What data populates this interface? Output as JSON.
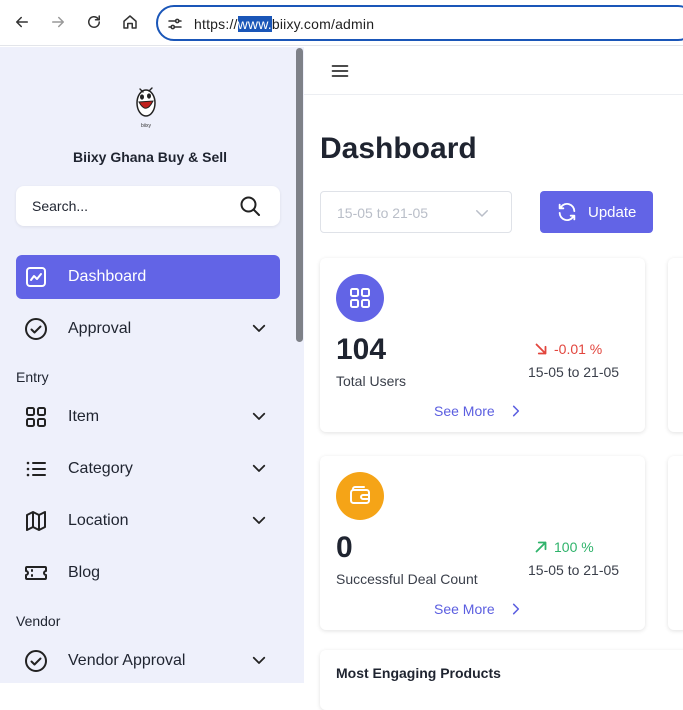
{
  "browser": {
    "url_prefix": "https://",
    "url_highlight": "www.",
    "url_rest": "biixy.com/admin"
  },
  "sidebar": {
    "brand": "Biixy Ghana Buy & Sell",
    "search_placeholder": "Search...",
    "items": [
      {
        "label": "Dashboard",
        "icon": "chart-line-icon"
      },
      {
        "label": "Approval",
        "icon": "check-circle-icon"
      },
      {
        "label": "Item",
        "icon": "grid-icon"
      },
      {
        "label": "Category",
        "icon": "list-icon"
      },
      {
        "label": "Location",
        "icon": "map-icon"
      },
      {
        "label": "Blog",
        "icon": "ticket-icon"
      },
      {
        "label": "Vendor Approval",
        "icon": "check-circle-icon"
      }
    ],
    "sections": [
      "Entry",
      "Vendor"
    ]
  },
  "main": {
    "title": "Dashboard",
    "date_range": "15-05 to 21-05",
    "update_label": "Update",
    "cards": [
      {
        "value": "104",
        "label": "Total Users",
        "trend": "-0.01 %",
        "range": "15-05 to 21-05",
        "link": "See More"
      },
      {
        "value": "0",
        "label": "Successful Deal Count",
        "trend": "100 %",
        "range": "15-05 to 21-05",
        "link": "See More"
      }
    ],
    "bottom_card_title": "Most Engaging Products"
  },
  "colors": {
    "accent": "#6264e6",
    "sidebar_bg": "#eef0fb",
    "trend_down": "#e2453d",
    "trend_up": "#2fb36b",
    "wallet_orange": "#f5a417"
  }
}
